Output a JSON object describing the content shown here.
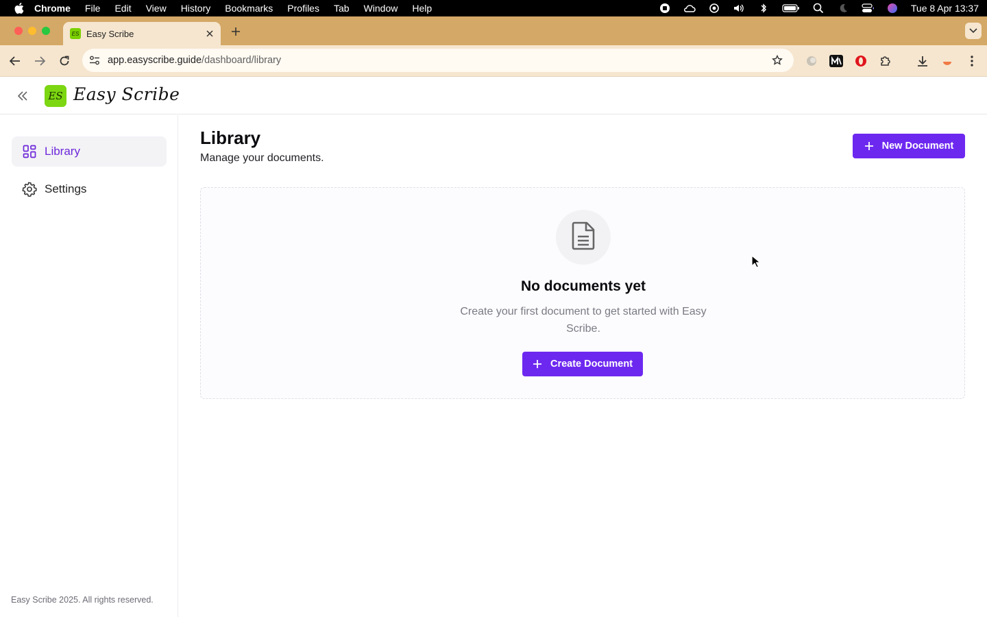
{
  "menubar": {
    "app": "Chrome",
    "items": [
      "File",
      "Edit",
      "View",
      "History",
      "Bookmarks",
      "Profiles",
      "Tab",
      "Window",
      "Help"
    ],
    "clock": "Tue 8 Apr  13:37",
    "status_icons": [
      "record-icon",
      "cloud-icon",
      "airplay-icon",
      "volume-icon",
      "bluetooth-icon",
      "battery-icon",
      "spotlight-icon",
      "moon-icon",
      "control-center-icon",
      "siri-icon"
    ]
  },
  "browser": {
    "tab_title": "Easy Scribe",
    "url_host": "app.easyscribe.guide",
    "url_path": "/dashboard/library"
  },
  "app": {
    "brand": "Easy Scribe",
    "logo_mark": "ES"
  },
  "sidebar": {
    "items": [
      {
        "label": "Library",
        "icon": "grid-icon",
        "active": true
      },
      {
        "label": "Settings",
        "icon": "gear-icon",
        "active": false
      }
    ],
    "footer": "Easy Scribe 2025. All rights reserved."
  },
  "main": {
    "title": "Library",
    "subtitle": "Manage your documents.",
    "new_button": "New Document",
    "empty": {
      "title": "No documents yet",
      "description": "Create your first document to get started with Easy Scribe.",
      "button": "Create Document"
    }
  },
  "colors": {
    "accent": "#6d28f0",
    "brand_green": "#7cd611",
    "tabstrip": "#d4a866"
  }
}
